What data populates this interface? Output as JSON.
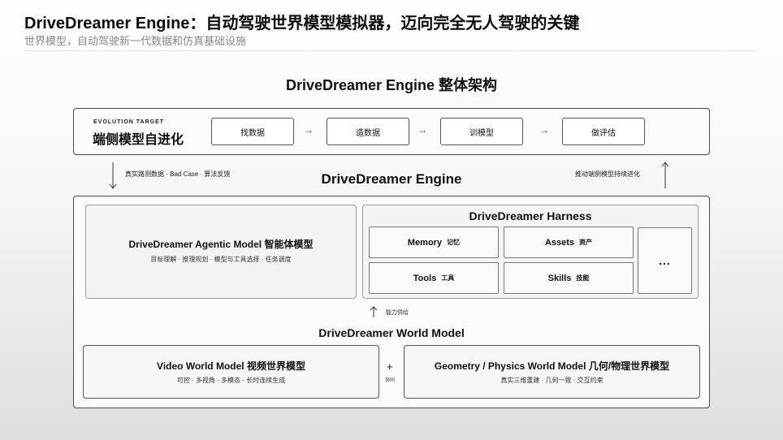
{
  "header": {
    "title": "DriveDreamer Engine：自动驾驶世界模型模拟器，迈向完全无人驾驶的关键",
    "subtitle": "世界模型，自动驾驶新一代数据和仿真基础设施"
  },
  "architecture": {
    "title": "DriveDreamer Engine 整体架构"
  },
  "evolution": {
    "tag": "EVOLUTION TARGET",
    "target": "端侧模型自进化",
    "steps": [
      "找数据",
      "造数据",
      "训模型",
      "做评估"
    ],
    "arrow_glyph": "→"
  },
  "flows": {
    "down_note": "真实路测数据 · Bad Case · 算法反馈",
    "up_note": "推动端侧模型持续进化"
  },
  "engine": {
    "title": "DriveDreamer Engine",
    "agentic": {
      "title": "DriveDreamer Agentic Model 智能体模型",
      "subtitle": "目标理解 · 推理规划 · 模型与工具选择 · 任务调度"
    },
    "harness": {
      "title": "DriveDreamer Harness",
      "cells": [
        {
          "en": "Memory",
          "cn": "记忆"
        },
        {
          "en": "Assets",
          "cn": "资产"
        },
        {
          "en": "Tools",
          "cn": "工具"
        },
        {
          "en": "Skills",
          "cn": "技能"
        }
      ],
      "more": "..."
    },
    "capability_note": "能力供给",
    "world_model": {
      "title": "DriveDreamer World Model",
      "video": {
        "title": "Video World Model 视频世界模型",
        "subtitle": "可控 · 多视角 · 多模态 · 长时连续生成"
      },
      "plus": "+",
      "plus_note": "协同",
      "geometry": {
        "title": "Geometry / Physics World Model 几何/物理世界模型",
        "subtitle": "真实三维重建 · 几何一致 · 交互约束"
      }
    }
  }
}
